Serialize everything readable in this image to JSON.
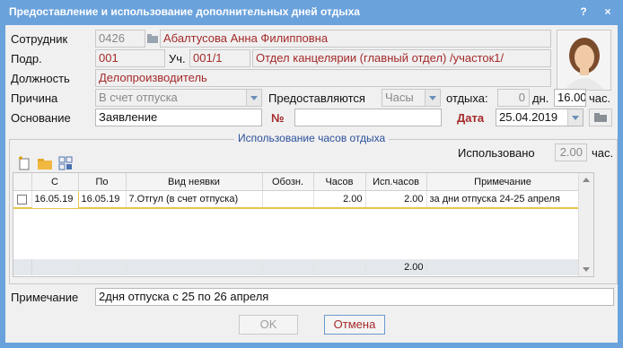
{
  "window": {
    "title": "Предоставление и использование дополнительных дней отдыха",
    "help": "?",
    "close": "×"
  },
  "form": {
    "employee_label": "Сотрудник",
    "employee_code": "0426",
    "employee_name": "Абалтусова Анна Филипповна",
    "dept_label": "Подр.",
    "dept_code": "001",
    "section_label": "Уч.",
    "section_code": "001/1",
    "section_name": "Отдел канцелярии (главный отдел) /участок1/",
    "position_label": "Должность",
    "position_value": "Делопроизводитель",
    "reason_label": "Причина",
    "reason_value": "В счет отпуска",
    "provided_label": "Предоставляются",
    "provided_value": "Часы",
    "rest_label": "отдыха:",
    "rest_days": "0",
    "days_unit": "дн.",
    "rest_hours": "16.00",
    "hours_unit": "час.",
    "basis_label": "Основание",
    "basis_value": "Заявление",
    "number_label": "№",
    "number_value": "",
    "date_label": "Дата",
    "date_value": "25.04.2019"
  },
  "usage": {
    "group_title": "Использование часов отдыха",
    "used_label": "Использовано",
    "used_value": "2.00",
    "used_unit": "час.",
    "columns": [
      "",
      "С",
      "По",
      "Вид неявки",
      "Обозн.",
      "Часов",
      "Исп.часов",
      "Примечание"
    ],
    "rows": [
      {
        "from": "16.05.19",
        "to": "16.05.19",
        "type": "7.Отгул (в счет отпуска)",
        "code": "",
        "hours": "2.00",
        "used_hours": "2.00",
        "note": "за дни отпуска 24-25 апреля"
      }
    ],
    "total_used": "2.00"
  },
  "footer": {
    "note_label": "Примечание",
    "note_value": "2дня отпуска с 25 по 26 апреля",
    "ok_label": "OK",
    "cancel_label": "Отмена"
  },
  "colors": {
    "titlebar": "#6aa2dc",
    "client": "#f0f0f0",
    "accent_red": "#a52a2a",
    "row_highlight": "#e8c44a"
  }
}
